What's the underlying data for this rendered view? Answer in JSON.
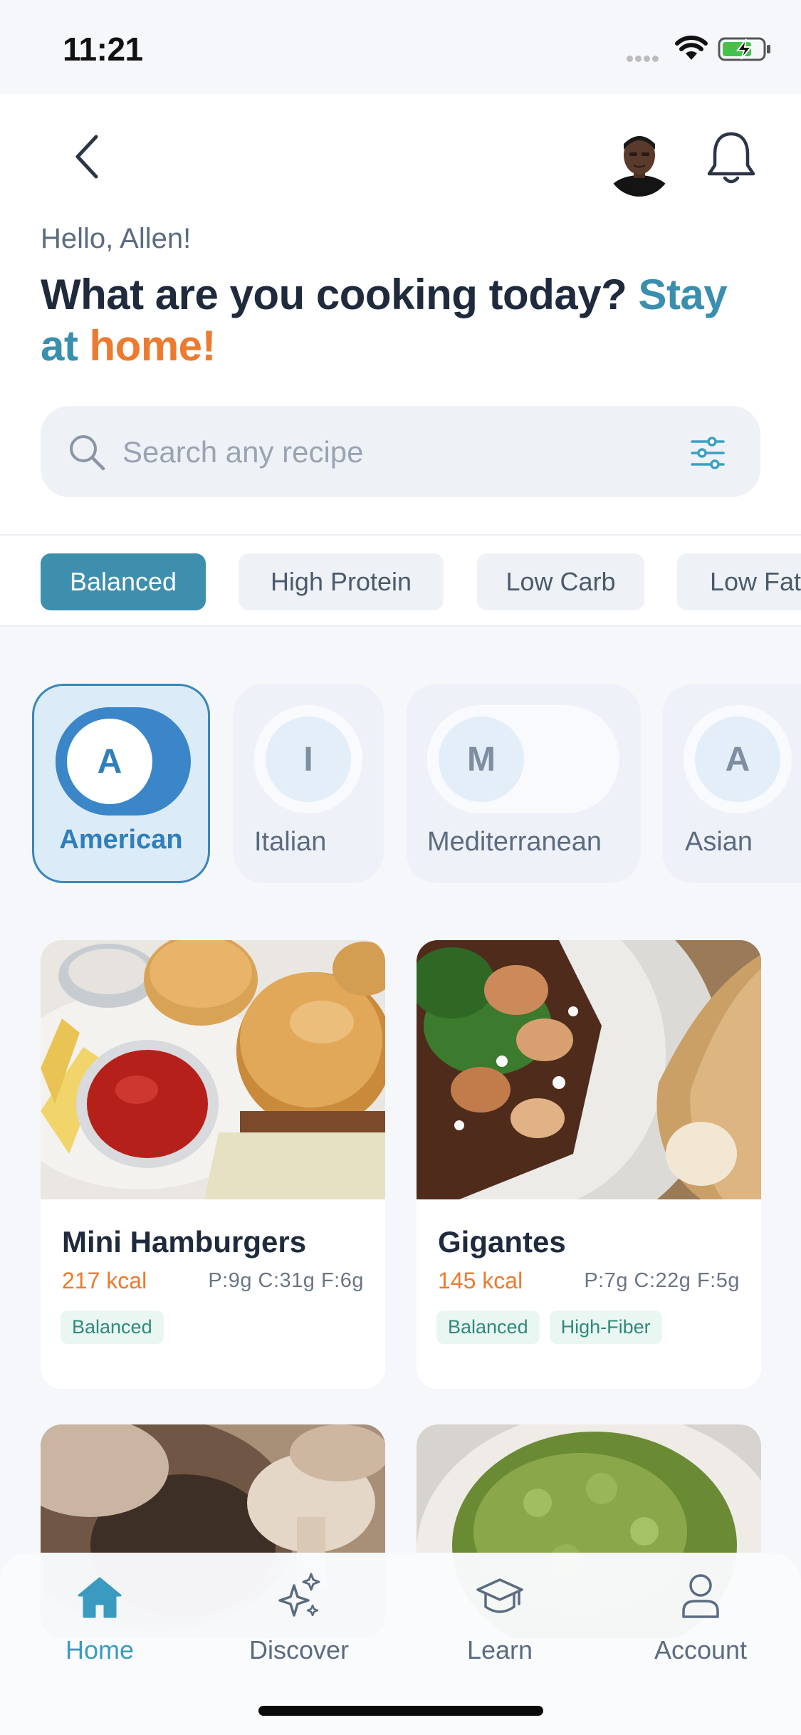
{
  "status_bar": {
    "time": "11:21"
  },
  "header": {
    "greeting": "Hello, Allen!",
    "headline_main": "What are you cooking today? ",
    "headline_teal1": "Stay",
    "headline_teal2": "at ",
    "headline_orange": "home!"
  },
  "search": {
    "placeholder": "Search any recipe"
  },
  "diet_filters": [
    {
      "label": "Balanced",
      "active": true
    },
    {
      "label": "High Protein"
    },
    {
      "label": "Low Carb"
    },
    {
      "label": "Low Fat"
    }
  ],
  "cuisines": [
    {
      "initial": "A",
      "label": "American",
      "active": true
    },
    {
      "initial": "I",
      "label": "Italian"
    },
    {
      "initial": "M",
      "label": "Mediterranean"
    },
    {
      "initial": "A",
      "label": "Asian"
    }
  ],
  "recipes": [
    {
      "title": "Mini Hamburgers",
      "kcal": "217 kcal",
      "macros": "P:9g C:31g F:6g",
      "tags": [
        "Balanced"
      ]
    },
    {
      "title": "Gigantes",
      "kcal": "145 kcal",
      "macros": "P:7g C:22g F:5g",
      "tags": [
        "Balanced",
        "High-Fiber"
      ]
    }
  ],
  "bottom_nav": [
    {
      "label": "Home",
      "icon": "home-icon",
      "active": true
    },
    {
      "label": "Discover",
      "icon": "sparkles-icon"
    },
    {
      "label": "Learn",
      "icon": "graduation-cap-icon"
    },
    {
      "label": "Account",
      "icon": "user-icon"
    }
  ],
  "colors": {
    "accent_teal": "#3e8fae",
    "accent_orange": "#ed7a2e",
    "tag_green": "#2f8a7a"
  }
}
